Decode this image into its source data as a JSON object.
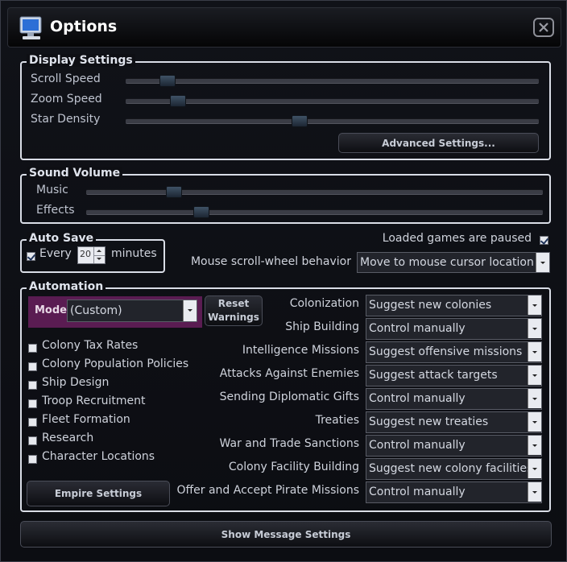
{
  "window": {
    "title": "Options"
  },
  "display": {
    "title": "Display Settings",
    "sliders": [
      {
        "label": "Scroll Speed",
        "value": 0.1
      },
      {
        "label": "Zoom Speed",
        "value": 0.125
      },
      {
        "label": "Star Density",
        "value": 0.42
      }
    ],
    "advanced_button": "Advanced Settings..."
  },
  "sound": {
    "title": "Sound Volume",
    "sliders": [
      {
        "label": "Music",
        "value": 0.19
      },
      {
        "label": "Effects",
        "value": 0.25
      }
    ]
  },
  "autosave": {
    "title": "Auto Save",
    "every_label": "Every",
    "every_checked": true,
    "minutes_value": "20",
    "minutes_label": "minutes"
  },
  "loaded_paused": {
    "label": "Loaded games are paused",
    "checked": true
  },
  "scroll_wheel": {
    "label": "Mouse scroll-wheel behavior",
    "value": "Move to mouse cursor location"
  },
  "automation": {
    "title": "Automation",
    "mode_label": "Mode",
    "mode_value": "(Custom)",
    "reset_line1": "Reset",
    "reset_line2": "Warnings",
    "checkboxes": [
      {
        "label": "Colony Tax Rates",
        "checked": false
      },
      {
        "label": "Colony Population Policies",
        "checked": false
      },
      {
        "label": "Ship Design",
        "checked": false
      },
      {
        "label": "Troop Recruitment",
        "checked": false
      },
      {
        "label": "Fleet Formation",
        "checked": false
      },
      {
        "label": "Research",
        "checked": false
      },
      {
        "label": "Character Locations",
        "checked": false
      }
    ],
    "empire_button": "Empire Settings",
    "rows": [
      {
        "label": "Colonization",
        "value": "Suggest new colonies"
      },
      {
        "label": "Ship Building",
        "value": "Control manually"
      },
      {
        "label": "Intelligence Missions",
        "value": "Suggest offensive missions"
      },
      {
        "label": "Attacks Against Enemies",
        "value": "Suggest attack targets"
      },
      {
        "label": "Sending Diplomatic Gifts",
        "value": "Control manually"
      },
      {
        "label": "Treaties",
        "value": "Suggest new treaties"
      },
      {
        "label": "War and Trade Sanctions",
        "value": "Control manually"
      },
      {
        "label": "Colony Facility Building",
        "value": "Suggest new colony facilities"
      },
      {
        "label": "Offer and Accept Pirate Missions",
        "value": "Control manually"
      }
    ]
  },
  "footer": {
    "message_button": "Show Message Settings"
  }
}
